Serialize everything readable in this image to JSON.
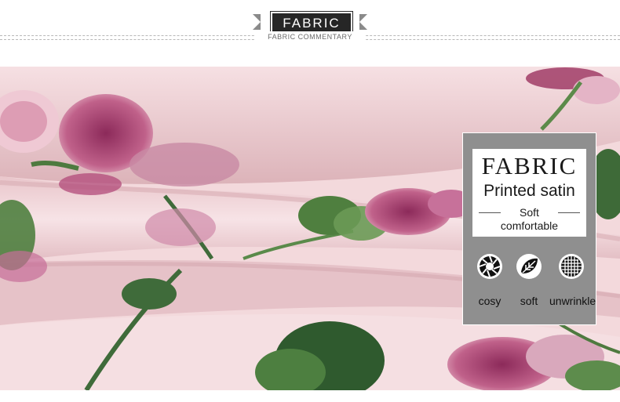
{
  "header": {
    "title": "FABRIC",
    "subtitle": "FABRIC COMMENTARY"
  },
  "card": {
    "title": "FABRIC",
    "material": "Printed satin",
    "qualities": [
      "Soft",
      "comfortable"
    ],
    "features": [
      {
        "label": "cosy",
        "icon": "aperture-icon"
      },
      {
        "label": "soft",
        "icon": "leaf-icon"
      },
      {
        "label": "unwrinkle",
        "icon": "grid-circle-icon"
      }
    ]
  },
  "colors": {
    "fabric_pink": "#f3d9dc",
    "flower_magenta": "#a83a6c",
    "leaf_green": "#3f6b3a",
    "card_gray": "#8f8f8f",
    "ribbon_dark": "#262626"
  }
}
